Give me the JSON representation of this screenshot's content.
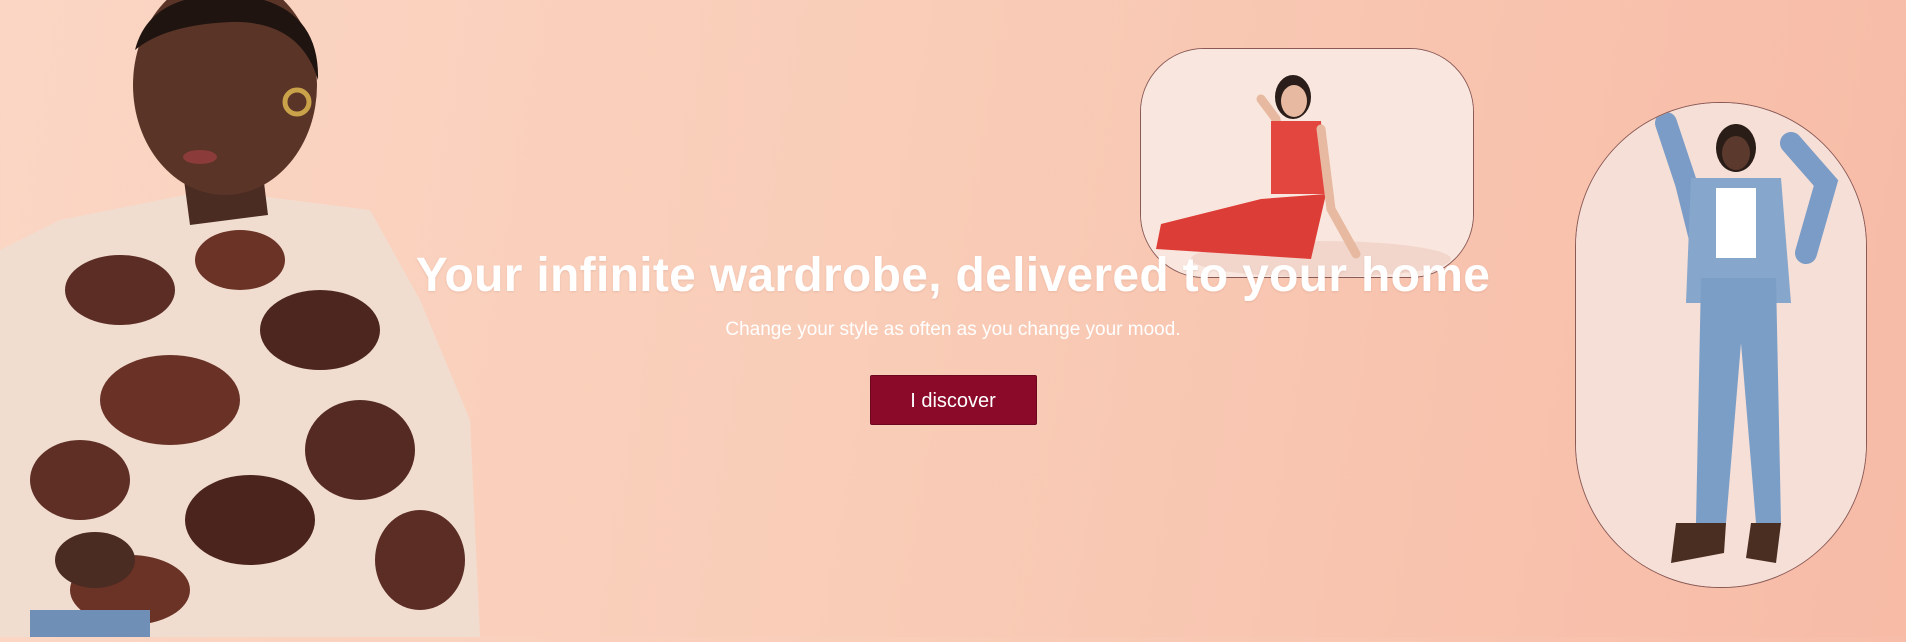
{
  "hero": {
    "headline": "Your infinite wardrobe, delivered to your home",
    "subheadline": "Change your style as often as you change your mood.",
    "cta_label": "I discover"
  },
  "images": {
    "left_model": "model-cow-print-jacket-photo",
    "top_frame": "model-red-denim-set-photo",
    "right_frame": "model-fringe-denim-jacket-photo"
  },
  "colors": {
    "background_start": "#fbd6c4",
    "background_end": "#f7bba6",
    "cta_background": "#8b0a2a",
    "text": "#ffffff",
    "frame_border": "#8a5a57"
  }
}
